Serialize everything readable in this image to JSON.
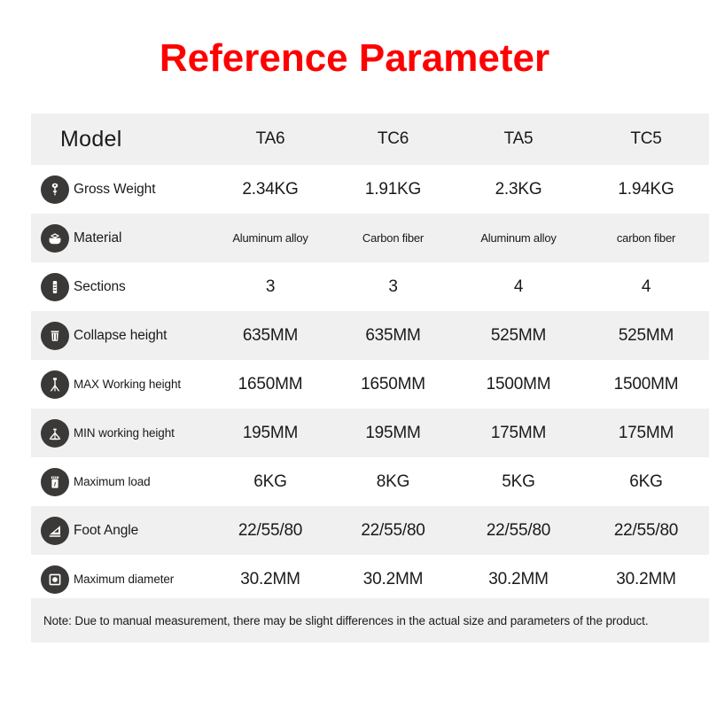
{
  "title": "Reference Parameter",
  "colors": {
    "title": "#ff0000",
    "row_shade": "#f0f0f0",
    "row_plain": "#ffffff",
    "icon_badge": "#3b3838",
    "text": "#1a1a1a"
  },
  "table": {
    "header": {
      "label": "Model",
      "columns": [
        "TA6",
        "TC6",
        "TA5",
        "TC5"
      ]
    },
    "rows": [
      {
        "icon": "hanging-scale-icon",
        "label": "Gross Weight",
        "values": [
          "2.34KG",
          "1.91KG",
          "2.3KG",
          "1.94KG"
        ]
      },
      {
        "icon": "material-bowl-icon",
        "label": "Material",
        "values": [
          "Aluminum alloy",
          "Carbon fiber",
          "Aluminum alloy",
          "carbon fiber"
        ]
      },
      {
        "icon": "tube-sections-icon",
        "label": "Sections",
        "values": [
          "3",
          "3",
          "4",
          "4"
        ]
      },
      {
        "icon": "folded-tripod-icon",
        "label": "Collapse height",
        "values": [
          "635MM",
          "635MM",
          "525MM",
          "525MM"
        ]
      },
      {
        "icon": "tall-tripod-icon",
        "label": "MAX Working height",
        "values": [
          "1650MM",
          "1650MM",
          "1500MM",
          "1500MM"
        ]
      },
      {
        "icon": "short-tripod-icon",
        "label": "MIN working height",
        "values": [
          "195MM",
          "195MM",
          "175MM",
          "175MM"
        ]
      },
      {
        "icon": "max-load-weight-icon",
        "label": "Maximum load",
        "values": [
          "6KG",
          "8KG",
          "5KG",
          "6KG"
        ]
      },
      {
        "icon": "angle-wedge-icon",
        "label": "Foot Angle",
        "values": [
          "22/55/80",
          "22/55/80",
          "22/55/80",
          "22/55/80"
        ]
      },
      {
        "icon": "diameter-circle-icon",
        "label": "Maximum diameter",
        "values": [
          "30.2MM",
          "30.2MM",
          "30.2MM",
          "30.2MM"
        ]
      }
    ]
  },
  "note": "Note: Due to manual measurement, there may be slight differences in the actual size and parameters of the product."
}
